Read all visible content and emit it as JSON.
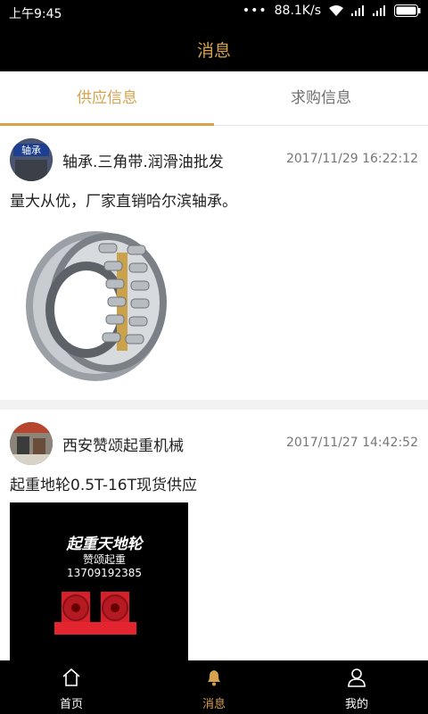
{
  "status_bar": {
    "time": "上午9:45",
    "dots": "•••",
    "network_speed": "88.1K/s"
  },
  "header": {
    "title": "消息"
  },
  "tabs": [
    {
      "label": "供应信息",
      "active": true
    },
    {
      "label": "求购信息",
      "active": false
    }
  ],
  "posts": [
    {
      "seller": "轴承.三角带.润滑油批发",
      "date": "2017/11/29 16:22:12",
      "description": "量大从优，厂家直销哈尔滨轴承。",
      "avatar_text": "轴承"
    },
    {
      "seller": "西安赞颂起重机械",
      "date": "2017/11/27 14:42:52",
      "description": "起重地轮0.5T-16T现货供应",
      "image_title": "起重天地轮",
      "image_brand": "赞颂起重",
      "image_phone": "13709192385"
    }
  ],
  "bottom_nav": [
    {
      "label": "首页",
      "icon": "home-icon",
      "active": false
    },
    {
      "label": "消息",
      "icon": "bell-icon",
      "active": true
    },
    {
      "label": "我的",
      "icon": "user-icon",
      "active": false
    }
  ],
  "colors": {
    "accent": "#d6a24e",
    "bar": "#000000"
  }
}
